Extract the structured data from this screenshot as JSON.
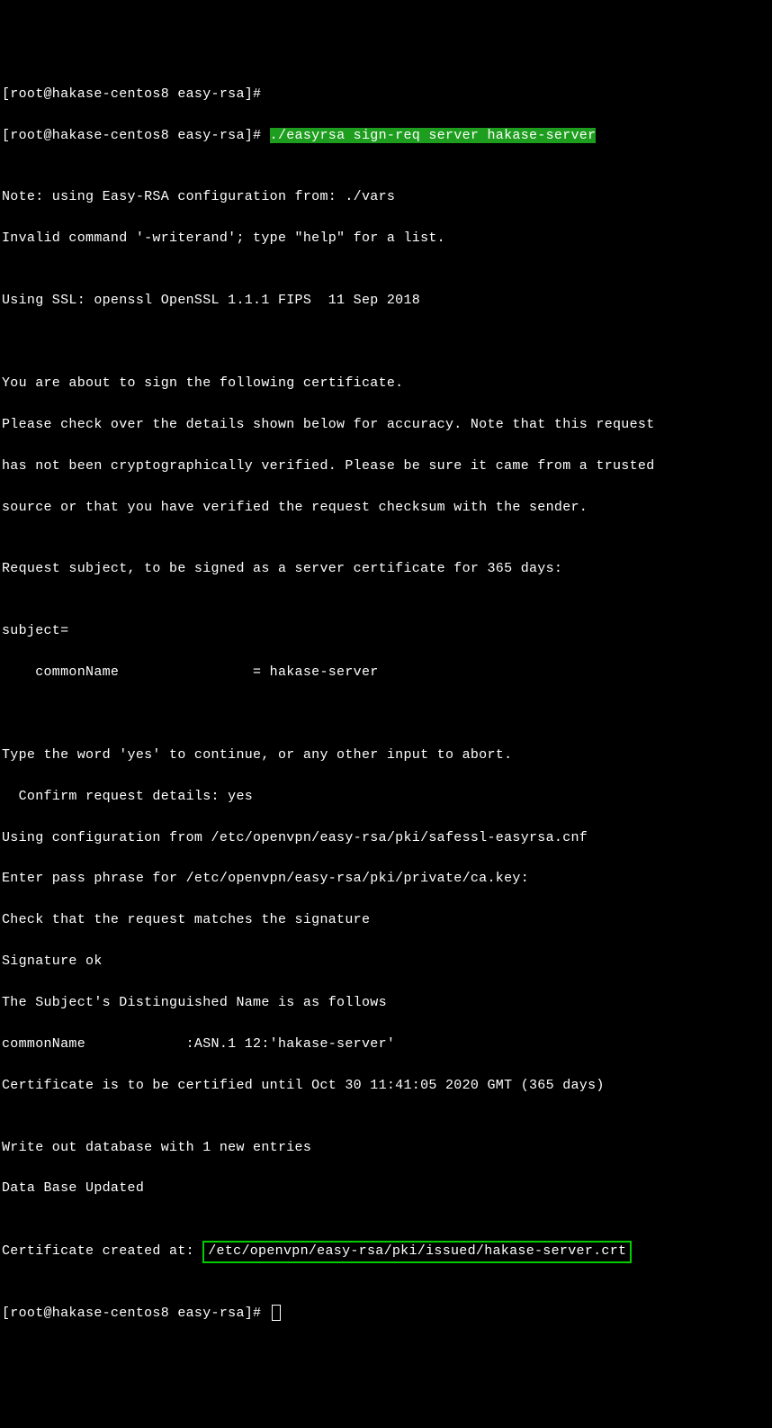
{
  "terminal": {
    "prompt1": "[root@hakase-centos8 easy-rsa]#",
    "prompt2": "[root@hakase-centos8 easy-rsa]# ",
    "command": "./easyrsa sign-req server hakase-server",
    "blank": "",
    "l_note": "Note: using Easy-RSA configuration from: ./vars",
    "l_invalid": "Invalid command '-writerand'; type \"help\" for a list.",
    "l_ssl": "Using SSL: openssl OpenSSL 1.1.1 FIPS  11 Sep 2018",
    "l_about": "You are about to sign the following certificate.",
    "l_please1": "Please check over the details shown below for accuracy. Note that this request",
    "l_please2": "has not been cryptographically verified. Please be sure it came from a trusted",
    "l_please3": "source or that you have verified the request checksum with the sender.",
    "l_reqsubj": "Request subject, to be signed as a server certificate for 365 days:",
    "l_subject": "subject=",
    "l_cn": "    commonName                = hakase-server",
    "l_type": "Type the word 'yes' to continue, or any other input to abort.",
    "l_confirm": "  Confirm request details: yes",
    "l_usingconf": "Using configuration from /etc/openvpn/easy-rsa/pki/safessl-easyrsa.cnf",
    "l_pass": "Enter pass phrase for /etc/openvpn/easy-rsa/pki/private/ca.key:",
    "l_checkreq": "Check that the request matches the signature",
    "l_sigok": "Signature ok",
    "l_dnfollows": "The Subject's Distinguished Name is as follows",
    "l_cnname": "commonName            :ASN.1 12:'hakase-server'",
    "l_certuntil": "Certificate is to be certified until Oct 30 11:41:05 2020 GMT (365 days)",
    "l_writedb": "Write out database with 1 new entries",
    "l_dbupdated": "Data Base Updated",
    "l_certcreated_prefix": "Certificate created at: ",
    "l_certcreated_path": "/etc/openvpn/easy-rsa/pki/issued/hakase-server.crt",
    "prompt3": "[root@hakase-centos8 easy-rsa]# "
  }
}
